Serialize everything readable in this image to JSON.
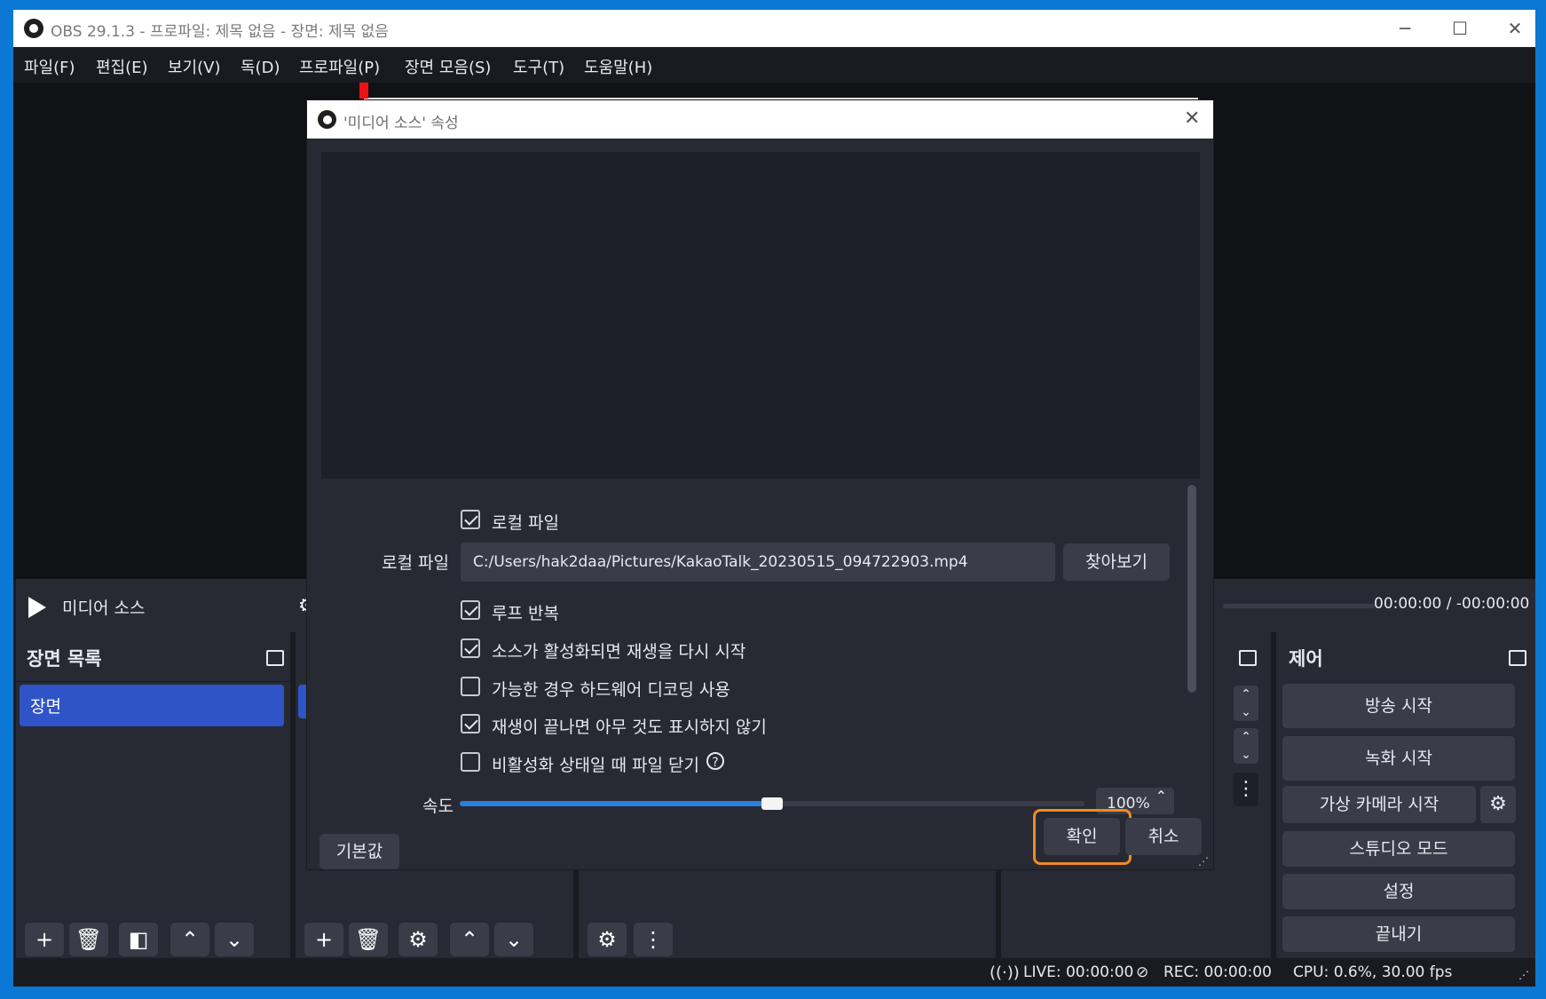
{
  "window": {
    "title": "OBS 29.1.3 - 프로파일: 제목 없음 - 장면: 제목 없음",
    "minimize": "─",
    "maximize": "☐",
    "close": "✕"
  },
  "menu": [
    "파일(F)",
    "편집(E)",
    "보기(V)",
    "독(D)",
    "프로파일(P)",
    "장면 모음(S)",
    "도구(T)",
    "도움말(H)"
  ],
  "source_bar": {
    "source_name": "미디어 소스",
    "time": "00:00:00  /  -00:00:00"
  },
  "scenes": {
    "header": "장면 목록",
    "items": [
      "장면"
    ]
  },
  "controls": {
    "header": "제어",
    "start_streaming": "방송 시작",
    "start_recording": "녹화 시작",
    "start_virtual_camera": "가상 카메라 시작",
    "studio_mode": "스튜디오 모드",
    "settings": "설정",
    "exit": "끝내기"
  },
  "status": {
    "live": "LIVE: 00:00:00",
    "rec": "REC: 00:00:00",
    "cpu": "CPU: 0.6%, 30.00 fps"
  },
  "dialog": {
    "title": "'미디어 소스' 속성",
    "local_file_checkbox": {
      "label": "로컬 파일",
      "checked": true
    },
    "local_file_label": "로컬 파일",
    "local_file_path": "C:/Users/hak2daa/Pictures/KakaoTalk_20230515_094722903.mp4",
    "browse": "찾아보기",
    "loop": {
      "label": "루프 반복",
      "checked": true
    },
    "restart_on_activate": {
      "label": "소스가 활성화되면 재생을 다시 시작",
      "checked": true
    },
    "hw_decoding": {
      "label": "가능한 경우 하드웨어 디코딩 사용",
      "checked": false
    },
    "hide_when_ended": {
      "label": "재생이 끝나면 아무 것도 표시하지 않기",
      "checked": true
    },
    "close_when_inactive": {
      "label": "비활성화 상태일 때 파일 닫기",
      "checked": false
    },
    "speed_label": "속도",
    "speed_value": "100%",
    "speed_fraction": 0.5,
    "defaults": "기본값",
    "ok": "확인",
    "cancel": "취소"
  },
  "colors": {
    "accent": "#2c7fe0",
    "highlight": "#f08a24",
    "selection": "#2f54c8"
  }
}
